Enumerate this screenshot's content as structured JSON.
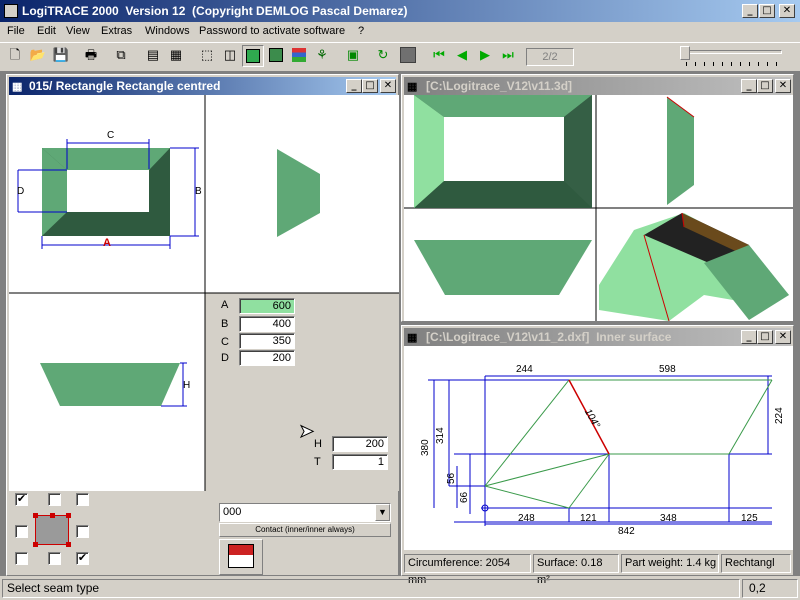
{
  "app": {
    "title": "LogiTRACE 2000  Version 12  (Copyright DEMLOG Pascal Demarez)"
  },
  "menu": [
    "File",
    "Edit",
    "View",
    "Extras",
    "Windows",
    "Password to activate software",
    "?"
  ],
  "toolbar": {
    "page_indicator": "2/2",
    "icons": [
      "new-icon",
      "open-icon",
      "save-icon",
      "print-icon",
      "copy-icon",
      "page-icon",
      "grid-icon",
      "wireframe-cube-icon",
      "outline-cube-icon",
      "green-cube-icon",
      "solid-cube-icon",
      "colors-icon",
      "tree-icon",
      "frame-icon",
      "rotate-icon",
      "stop-icon",
      "first-icon",
      "previous-icon",
      "next-icon",
      "last-icon"
    ]
  },
  "piece_window": {
    "title": "015/ Rectangle Rectangle centred",
    "dims": {
      "A": "A",
      "B": "B",
      "C": "C",
      "D": "D",
      "H": "H"
    },
    "params": [
      {
        "label": "A",
        "value": "600",
        "highlight": true
      },
      {
        "label": "B",
        "value": "400",
        "highlight": false
      },
      {
        "label": "C",
        "value": "350",
        "highlight": false
      },
      {
        "label": "D",
        "value": "200",
        "highlight": false
      }
    ],
    "height_params": [
      {
        "label": "H",
        "value": "200"
      },
      {
        "label": "T",
        "value": "1"
      }
    ],
    "seam_combo_value": "000",
    "contact_button": "Contact (inner/inner always)",
    "checkboxes": [
      true,
      false,
      false,
      false,
      false,
      false,
      false,
      true
    ]
  },
  "view3d_window": {
    "title": "[C:\\Logitrace_V12\\v11.3d]"
  },
  "dxf_window": {
    "title": "[C:\\Logitrace_V12\\v11_2.dxf]  Inner surface",
    "dims": {
      "top_left": "244",
      "top_right": "598",
      "diag": "104°",
      "left_outer": "380",
      "left_inner": "314",
      "right": "224",
      "small_left": "56",
      "small_bottom": "66",
      "bottom_a": "248",
      "bottom_b": "121",
      "bottom_c": "348",
      "bottom_d": "125",
      "total": "842"
    },
    "status": {
      "circumference": "Circumference: 2054 mm",
      "surface": "Surface: 0.18 m²",
      "weight": "Part weight: 1.4 kg",
      "type": "Rechtangl"
    }
  },
  "statusbar": {
    "message": "Select seam type",
    "coord": "0,2"
  },
  "colors": {
    "face_green": "#5fa876",
    "light_green": "#90e0a0",
    "dark_green": "#2f5a3f",
    "dim_blue": "#0000cc",
    "dim_red": "#cc0000"
  }
}
